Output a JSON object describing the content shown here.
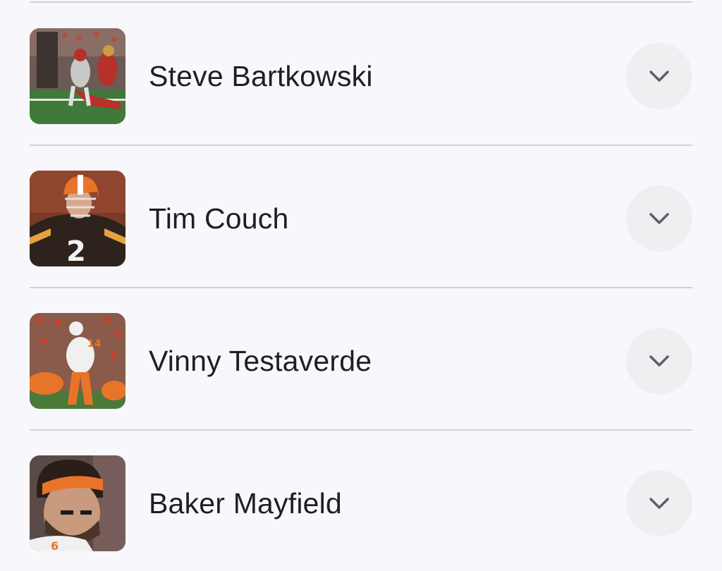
{
  "players": [
    {
      "name": "Steve Bartkowski",
      "photo": "steve-bartkowski-photo",
      "action_icon": "chevron-down-icon"
    },
    {
      "name": "Tim Couch",
      "photo": "tim-couch-photo",
      "action_icon": "chevron-down-icon"
    },
    {
      "name": "Vinny Testaverde",
      "photo": "vinny-testaverde-photo",
      "action_icon": "chevron-down-icon"
    },
    {
      "name": "Baker Mayfield",
      "photo": "baker-mayfield-photo",
      "action_icon": "chevron-down-icon"
    }
  ],
  "colors": {
    "background": "#f8f8fc",
    "divider": "#d2d2d6",
    "text": "#1f1f23",
    "expand_button": "#efeff2",
    "chevron": "#5f5f66"
  }
}
